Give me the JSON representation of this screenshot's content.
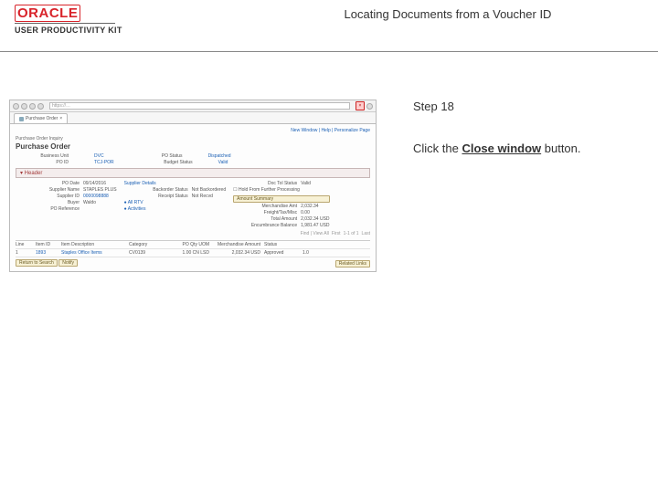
{
  "header": {
    "brand": "ORACLE",
    "kit": "USER PRODUCTIVITY KIT",
    "title": "Locating Documents from a Voucher ID"
  },
  "instruction": {
    "step_label": "Step 18",
    "text_lead": "Click the ",
    "text_bold": "Close window",
    "text_tail": " button."
  },
  "shot": {
    "tab_label": "Purchase Order",
    "links_right": "New Window | Help | Personalize Page",
    "breadcrumb": "Purchase Order Inquiry",
    "page_heading": "Purchase Order",
    "row1": {
      "l1": "Business Unit",
      "v1": "DVC",
      "l2": "PO Status",
      "v2": "Dispatched"
    },
    "row2": {
      "l1": "PO ID",
      "v1": "TCJ-POR",
      "l2": "Budget Status",
      "v2": "Valid"
    },
    "header_toggle": "▾ Header",
    "left_col": [
      {
        "l": "PO Date",
        "v": "09/14/2016"
      },
      {
        "l": "Supplier Name",
        "v": "STAPLES PLUS"
      },
      {
        "l": "Supplier ID",
        "v": "0000098888"
      },
      {
        "l": "Buyer",
        "v": "Waldo"
      },
      {
        "l": "PO Reference",
        "v": ""
      }
    ],
    "mid_col": [
      {
        "l": "Supplier Details",
        "v": ""
      },
      {
        "l": "Backorder Status",
        "v": "Not Backordered"
      },
      {
        "l": "Receipt Status",
        "v": "Not Recvd"
      },
      {
        "l": "",
        "v": "● All RTV"
      },
      {
        "l": "",
        "v": "● Activities"
      }
    ],
    "right_col": [
      {
        "l": "Doc Tol Status",
        "v": "Valid"
      },
      {
        "l": "Amount Summary",
        "v": ""
      },
      {
        "l": "Merchandise Amt",
        "v": "2,032.34"
      },
      {
        "l": "Freight/Tax/Misc",
        "v": "0.00"
      },
      {
        "l": "Total Amount",
        "v": "2,032.34 USD"
      },
      {
        "l": "Encumbrance Balance",
        "v": "1,981.47 USD"
      }
    ],
    "right_extra": {
      "l": "",
      "v": "☐ Hold From Further Processing"
    },
    "account_btn": "Amount Summary",
    "pager": {
      "findlbl": "Find | View All",
      "first": "First",
      "range": "1-1 of 1",
      "last": "Last"
    },
    "cols": {
      "line": "Line",
      "item": "Item ID",
      "desc": "Item Description",
      "cat": "Category",
      "uom": "PO Qty  UOM",
      "amt": "Merchandise Amount",
      "stat": "Status",
      "br": " "
    },
    "trow": {
      "line": "1",
      "item": "1893",
      "desc": "Staples Office Items",
      "cat": "CV0139",
      "uom": "1.00 CN LSD",
      "amt": "2,032.34 USD",
      "stat": "Approved",
      "br": "1.0"
    },
    "foot_left": "Return to Search",
    "foot_help": "Notify",
    "foot_right": "Related Links"
  }
}
